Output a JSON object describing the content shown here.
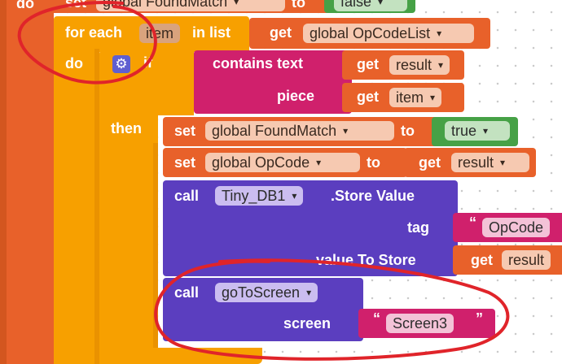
{
  "outer_do": "do",
  "top_set": {
    "set": "set",
    "var": "global FoundMatch",
    "to": "to",
    "value": "false"
  },
  "foreach": {
    "for_each": "for each",
    "item_var": "item",
    "in_list": "in list",
    "get": "get",
    "list_var": "global OpCodeList",
    "do": "do"
  },
  "if_block": {
    "if": "if",
    "then": "then"
  },
  "contains": {
    "label": "contains text",
    "piece": "piece",
    "get1": "get",
    "var1": "result",
    "get2": "get",
    "var2": "item"
  },
  "set_found": {
    "set": "set",
    "var": "global FoundMatch",
    "to": "to",
    "value": "true"
  },
  "set_opcode": {
    "set": "set",
    "var": "global OpCode",
    "to": "to",
    "get": "get",
    "value": "result"
  },
  "store": {
    "call": "call",
    "component": "Tiny_DB1",
    "method": ".Store Value",
    "tag": "tag",
    "tag_value": "OpCode",
    "value_to_store": "value To Store",
    "get": "get",
    "var": "result"
  },
  "goto": {
    "call": "call",
    "proc": "goToScreen",
    "screen": "screen",
    "screen_value": "Screen3"
  },
  "colors": {
    "orange": "#e8612a",
    "amber": "#f7a000",
    "magenta": "#d0206c",
    "purple": "#5b3ebf",
    "green": "#46a146",
    "annotation_red": "#e0242a"
  }
}
